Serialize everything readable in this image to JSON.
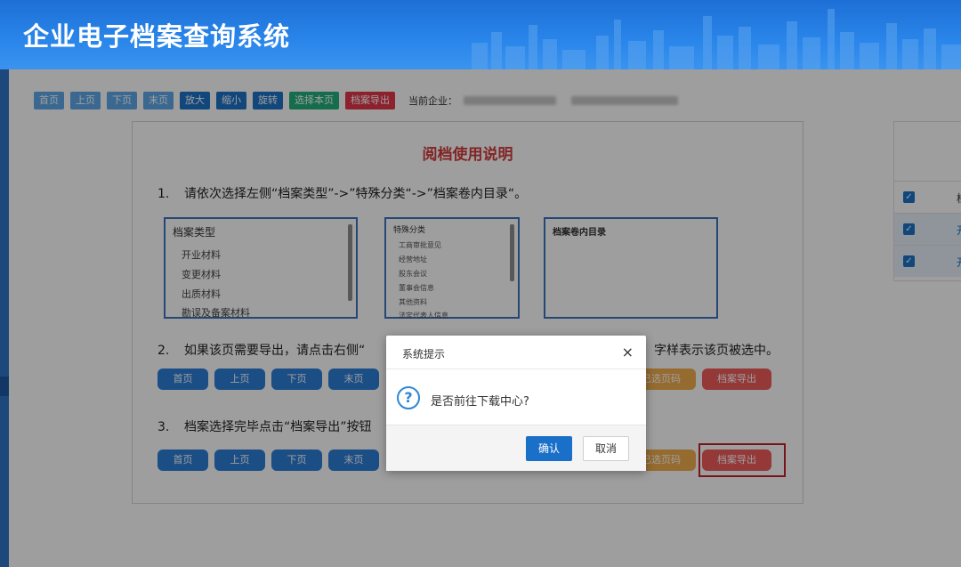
{
  "header": {
    "title": "企业电子档案查询系统"
  },
  "toolbar": {
    "buttons": [
      "首页",
      "上页",
      "下页",
      "末页",
      "放大",
      "缩小",
      "旋转",
      "选择本页",
      "档案导出"
    ],
    "current_company_label": "当前企业："
  },
  "instructions": {
    "title": "阅档使用说明",
    "step1": {
      "num": "1.",
      "text": "请依次选择左侧“档案类型”->”特殊分类“->”档案卷内目录“。"
    },
    "panel1": {
      "title": "档案类型",
      "items": [
        "开业材料",
        "变更材料",
        "出质材料",
        "勘误及备案材料"
      ]
    },
    "panel2": {
      "title": "特殊分类",
      "items": [
        "工商审批意见",
        "经营地址",
        "股东会议",
        "董事会信息",
        "其他资料",
        "法定代表人信息"
      ]
    },
    "panel3": {
      "title": "档案卷内目录"
    },
    "step2": {
      "num": "2.",
      "text_left": "如果该页需要导出，请点击右侧“",
      "text_right": "字样表示该页被选中。"
    },
    "step3": {
      "num": "3.",
      "text": "档案选择完毕点击“档案导出”按钮"
    },
    "row_buttons": [
      "首页",
      "上页",
      "下页",
      "末页"
    ],
    "row_btn_select": "已选页码",
    "row_btn_export": "档案导出"
  },
  "right_panel": {
    "col_header": "档",
    "rows": [
      "开",
      "开"
    ]
  },
  "dialog": {
    "title": "系统提示",
    "close": "×",
    "icon": "?",
    "message": "是否前往下载中心?",
    "confirm": "确认",
    "cancel": "取消"
  }
}
